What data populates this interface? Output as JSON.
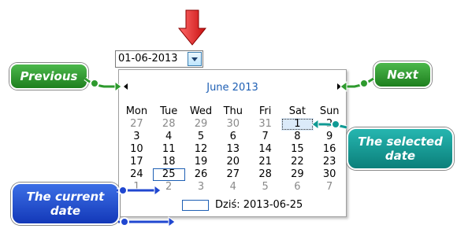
{
  "date_input": {
    "value": "01-06-2013"
  },
  "calendar": {
    "month_title": "June 2013",
    "weekdays": [
      "Mon",
      "Tue",
      "Wed",
      "Thu",
      "Fri",
      "Sat",
      "Sun"
    ],
    "weeks": [
      [
        "27",
        "28",
        "29",
        "30",
        "31",
        "1",
        "2"
      ],
      [
        "3",
        "4",
        "5",
        "6",
        "7",
        "8",
        "9"
      ],
      [
        "10",
        "11",
        "12",
        "13",
        "14",
        "15",
        "16"
      ],
      [
        "17",
        "18",
        "19",
        "20",
        "21",
        "22",
        "23"
      ],
      [
        "24",
        "25",
        "26",
        "27",
        "28",
        "29",
        "30"
      ],
      [
        "1",
        "2",
        "3",
        "4",
        "5",
        "6",
        "7"
      ]
    ],
    "today_text": "Dziś: 2013-06-25"
  },
  "callouts": {
    "previous": "Previous",
    "next": "Next",
    "selected": "The selected date",
    "current": "The current date"
  },
  "icons": {
    "dropdown": "chevron-down-icon",
    "prev": "triangle-left-icon",
    "next": "triangle-right-icon",
    "indicator": "red-down-arrow-icon"
  },
  "colors": {
    "green": "#2e9a2e",
    "teal": "#109a94",
    "blue": "#2047d0",
    "month": "#1e5fb4",
    "red": "#e62020"
  }
}
